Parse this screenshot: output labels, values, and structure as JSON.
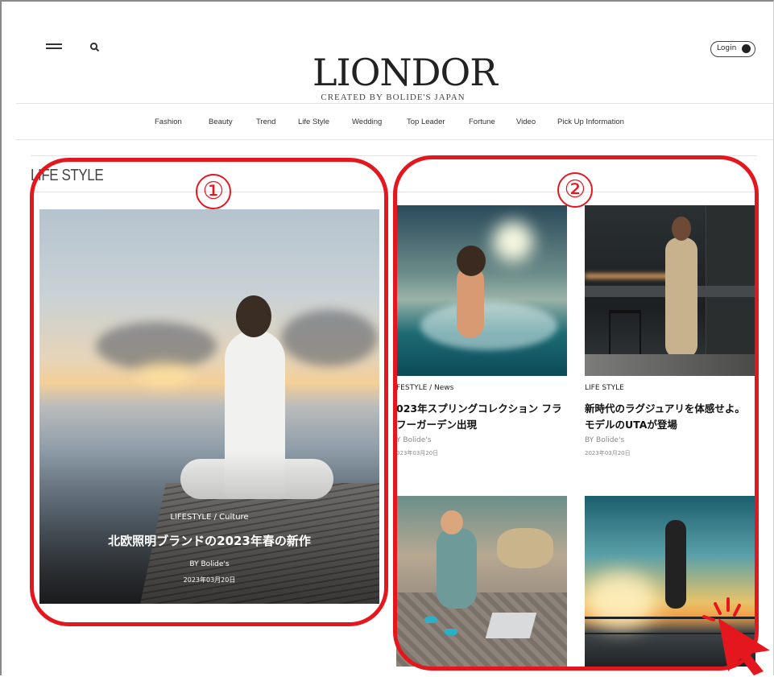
{
  "header": {
    "logo": "LIONDOR",
    "tagline": "CREATED BY BOLIDE'S JAPAN",
    "login_label": "Login",
    "icons": {
      "menu": "hamburger-menu-icon",
      "search": "search-icon",
      "user": "user-icon"
    }
  },
  "nav": {
    "items": [
      "Fashion",
      "Beauty",
      "Trend",
      "Life Style",
      "Wedding",
      "Top Leader",
      "Fortune",
      "Video",
      "Pick Up Information"
    ]
  },
  "section": {
    "title": "LIFE STYLE"
  },
  "featured": {
    "category": "LIFESTYLE / Culture",
    "title": "北欧照明ブランドの2023年春の新作",
    "author": "BY  Bolide's",
    "date": "2023年03月20日"
  },
  "grid": {
    "cards": [
      {
        "category": "FESTYLE / News",
        "title": "023年スプリングコレクション フラ\nフーガーデン出現",
        "author": "Y  Bolide's",
        "date": "023年03月20日"
      },
      {
        "category": "LIFE STYLE",
        "title": "新時代のラグジュアリを体感せよ。\nモデルのUTAが登場",
        "author": "BY  Bolide's",
        "date": "2023年03月20日"
      }
    ]
  },
  "annotations": {
    "one": "①",
    "two": "②",
    "accent": "#e4171f"
  }
}
